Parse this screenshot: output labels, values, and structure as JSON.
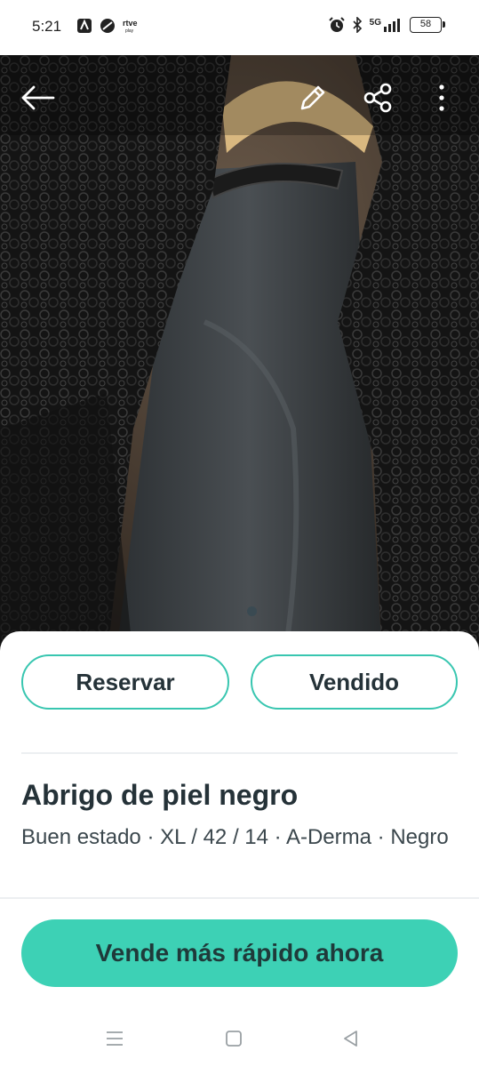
{
  "status_bar": {
    "time": "5:21",
    "network": "5G",
    "battery": "58",
    "left_icons": [
      "maps-icon",
      "no-disturb-icon",
      "rtve-play-icon"
    ],
    "right_icons": [
      "alarm-icon",
      "bluetooth-icon",
      "signal-icon"
    ]
  },
  "toolbar": {
    "back_icon": "arrow-left-icon",
    "edit_icon": "pencil-icon",
    "share_icon": "share-icon",
    "more_icon": "more-vertical-icon"
  },
  "photo": {
    "description_icon": "product-photo",
    "pager_total": 1,
    "pager_active": 1
  },
  "actions": {
    "reserve_label": "Reservar",
    "sold_label": "Vendido",
    "accent_color": "#38c6b0"
  },
  "product": {
    "title": "Abrigo de piel negro",
    "details": "Buen estado · XL / 42 / 14 · A-Derma · Negro"
  },
  "promo": {
    "button_label": "Vende más rápido ahora",
    "button_color": "#3dd1b5"
  },
  "nav_bar": {
    "items": [
      "menu-icon",
      "home-square-icon",
      "back-triangle-icon"
    ]
  }
}
